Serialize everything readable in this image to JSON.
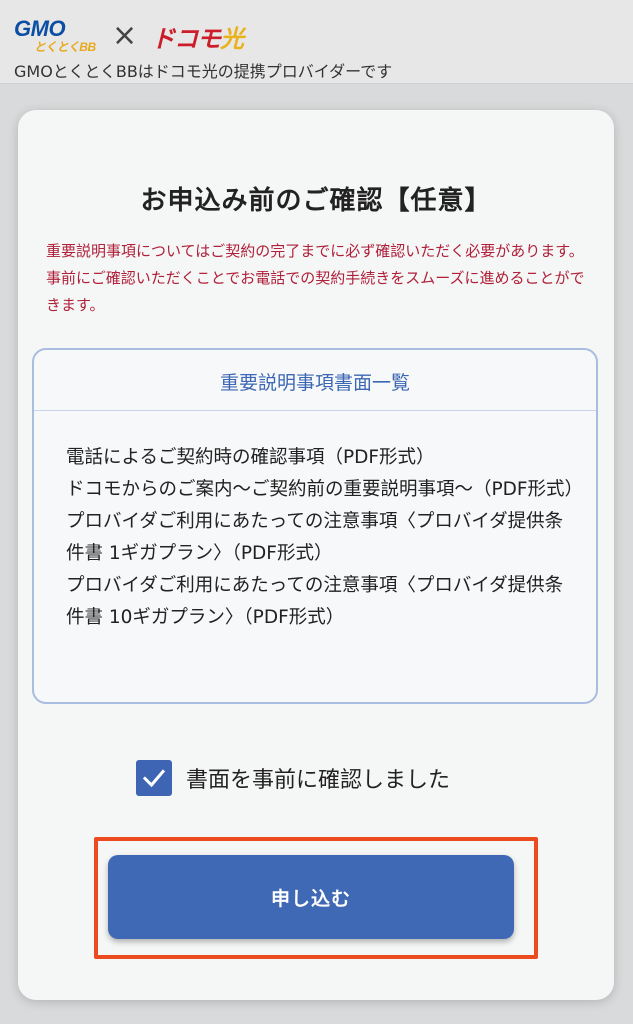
{
  "header": {
    "gmo_logo_text": "GMO",
    "gmo_logo_sub": "とくとくBB",
    "times_symbol": "×",
    "docomo_logo_text": "ドコモ",
    "hikari_logo_text": "光",
    "tagline": "GMOとくとくBBはドコモ光の提携プロバイダーです"
  },
  "modal": {
    "title": "お申込み前のご確認【任意】",
    "notice": "重要説明事項についてはご契約の完了までに必ず確認いただく必要があります。事前にご確認いただくことでお電話での契約手続きをスムーズに進めることができます。",
    "docs": {
      "title": "重要説明事項書面一覧",
      "items": [
        "電話によるご契約時の確認事項（PDF形式）",
        "ドコモからのご案内〜ご契約前の重要説明事項〜（PDF形式）",
        "プロバイダご利用にあたっての注意事項〈プロバイダ提供条件書 1ギガプラン〉（PDF形式）",
        "プロバイダご利用にあたっての注意事項〈プロバイダ提供条件書 10ギガプラン〉（PDF形式）"
      ]
    },
    "confirm_checkbox": {
      "label": "書面を事前に確認しました",
      "checked": true
    },
    "apply_button_label": "申し込む"
  },
  "colors": {
    "accent_blue": "#4069b5",
    "notice_red": "#b0203a",
    "highlight_orange": "#ec4a1f"
  }
}
